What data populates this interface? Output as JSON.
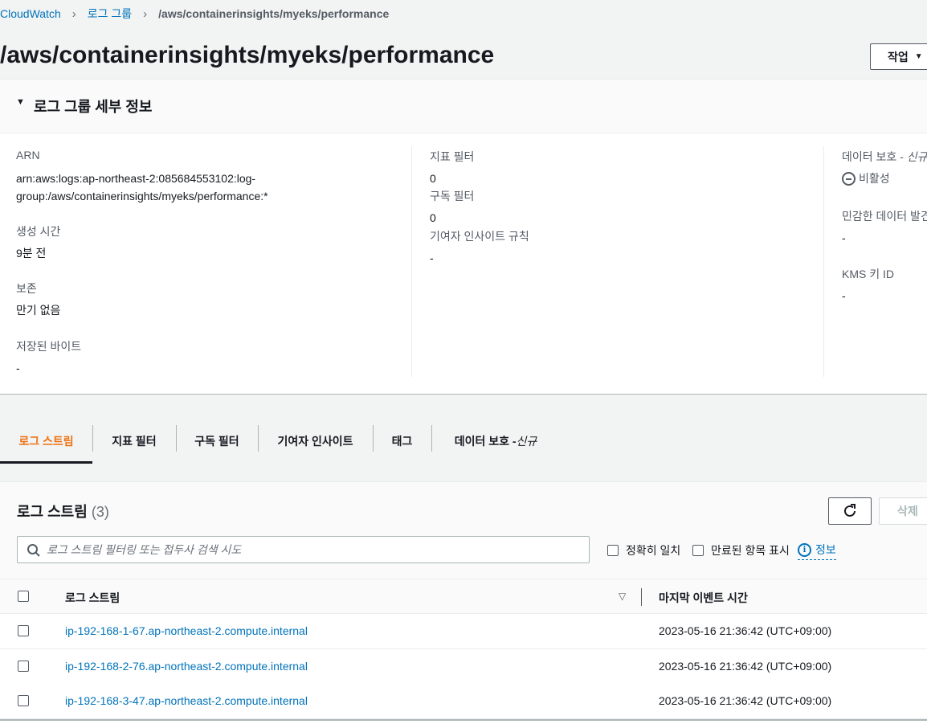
{
  "breadcrumb": {
    "items": [
      "CloudWatch",
      "로그 그룹",
      "/aws/containerinsights/myeks/performance"
    ]
  },
  "page": {
    "title": "/aws/containerinsights/myeks/performance",
    "actions_label": "작업"
  },
  "details": {
    "title": "로그 그룹 세부 정보",
    "arn_label": "ARN",
    "arn_line1": "arn:aws:logs:ap-northeast-2:085684553102:log-",
    "arn_line2": "group:/aws/containerinsights/myeks/performance:*",
    "created_label": "생성 시간",
    "created_value": "9분 전",
    "retention_label": "보존",
    "retention_value": "만기 없음",
    "stored_bytes_label": "저장된 바이트",
    "stored_bytes_value": "-",
    "metric_filters_label": "지표 필터",
    "metric_filters_value": "0",
    "subscription_filters_label": "구독 필터",
    "subscription_filters_value": "0",
    "contributor_rules_label": "기여자 인사이트 규칙",
    "contributor_rules_value": "-",
    "data_protection_label": "데이터 보호 - ",
    "data_protection_new": "신규",
    "data_protection_value": "비활성",
    "sensitive_data_label": "민감한 데이터 발견",
    "sensitive_data_value": "-",
    "kms_label": "KMS 키 ID",
    "kms_value": "-"
  },
  "tabs": [
    {
      "label": "로그 스트림",
      "active": true
    },
    {
      "label": "지표 필터"
    },
    {
      "label": "구독 필터"
    },
    {
      "label": "기여자 인사이트"
    },
    {
      "label": "태그"
    },
    {
      "label": "데이터 보호 - ",
      "suffix": "신규"
    }
  ],
  "streams": {
    "title": "로그 스트림",
    "count": "(3)",
    "delete_label": "삭제",
    "search_placeholder": "로그 스트림 필터링 또는 접두사 검색 시도",
    "exact_match_label": "정확히 일치",
    "show_expired_label": "만료된 항목 표시",
    "info_label": "정보",
    "col_stream": "로그 스트림",
    "col_last_event": "마지막 이벤트 시간",
    "rows": [
      {
        "name": "ip-192-168-1-67.ap-northeast-2.compute.internal",
        "time": "2023-05-16 21:36:42 (UTC+09:00)"
      },
      {
        "name": "ip-192-168-2-76.ap-northeast-2.compute.internal",
        "time": "2023-05-16 21:36:42 (UTC+09:00)"
      },
      {
        "name": "ip-192-168-3-47.ap-northeast-2.compute.internal",
        "time": "2023-05-16 21:36:42 (UTC+09:00)"
      }
    ]
  },
  "icons": {
    "breadcrumb_separator": "chevron-right-icon",
    "actions_caret": "caret-down-icon",
    "details_toggle": "caret-down-icon",
    "disabled_status": "minus-circle-icon",
    "refresh": "refresh-icon",
    "search": "search-icon",
    "info": "info-icon",
    "sort": "sort-down-icon"
  },
  "colors": {
    "link": "#0073bb",
    "active_tab": "#ec7211",
    "background": "#f2f3f3"
  }
}
